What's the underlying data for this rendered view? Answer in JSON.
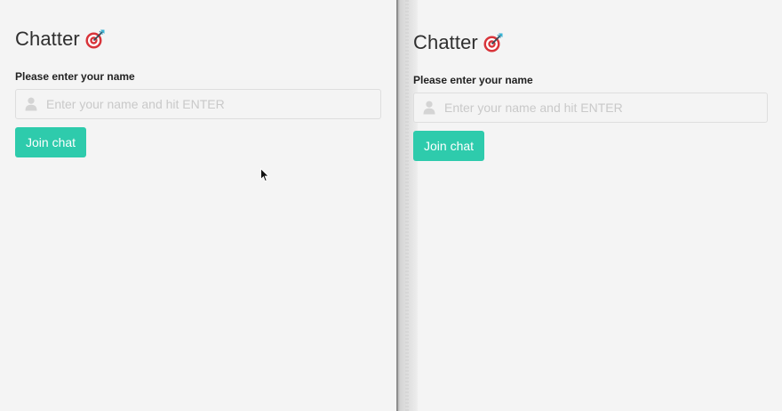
{
  "app": {
    "title": "Chatter",
    "title_emoji_icon": "bullseye-dart-icon"
  },
  "panes": [
    {
      "title": "Chatter",
      "name_label": "Please enter your name",
      "name_input": {
        "value": "",
        "placeholder": "Enter your name and hit ENTER",
        "icon": "user-icon"
      },
      "join_button_label": "Join chat"
    },
    {
      "title": "Chatter",
      "name_label": "Please enter your name",
      "name_input": {
        "value": "",
        "placeholder": "Enter your name and hit ENTER",
        "icon": "user-icon"
      },
      "join_button_label": "Join chat"
    }
  ],
  "colors": {
    "background": "#f4f4f4",
    "accent": "#2ecbac",
    "text": "#363636",
    "placeholder": "#c9c9c9",
    "border": "#dedede"
  }
}
